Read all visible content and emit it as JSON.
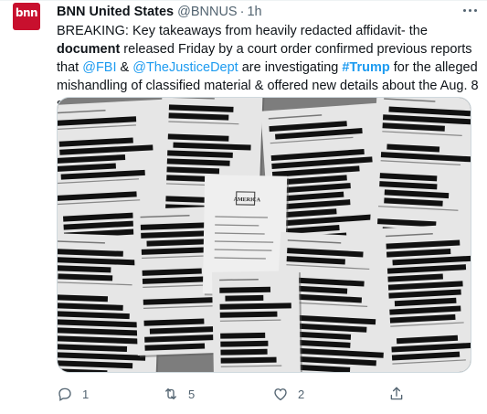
{
  "tweet": {
    "avatar": {
      "logo_text": "bnn",
      "color": "#c8102e"
    },
    "author": {
      "name": "BNN United States",
      "handle": "@BNNUS",
      "separator": "·",
      "time": "1h"
    },
    "text_parts": {
      "p1": "BREAKING: Key takeaways from heavily redacted affidavit- the ",
      "p2": "document",
      "p3": " released Friday by a court order confirmed previous reports that ",
      "p4": "@FBI",
      "p5": " & ",
      "p6": "@TheJusticeDept",
      "p7": " are investigating ",
      "p8": "#Trump",
      "p9": " for the alleged mishandling of classified material & offered new details about the Aug. 8 search."
    },
    "media": {
      "description_icon": "redacted-document-pages-photo",
      "page_cover_text": "AMERICA"
    },
    "actions": {
      "reply": {
        "icon": "reply-icon",
        "count": "1"
      },
      "retweet": {
        "icon": "retweet-icon",
        "count": "5"
      },
      "like": {
        "icon": "heart-icon",
        "count": "2"
      },
      "share": {
        "icon": "share-icon"
      }
    },
    "colors": {
      "link": "#1d9bf0",
      "muted": "#536471",
      "text": "#0f1419"
    }
  }
}
